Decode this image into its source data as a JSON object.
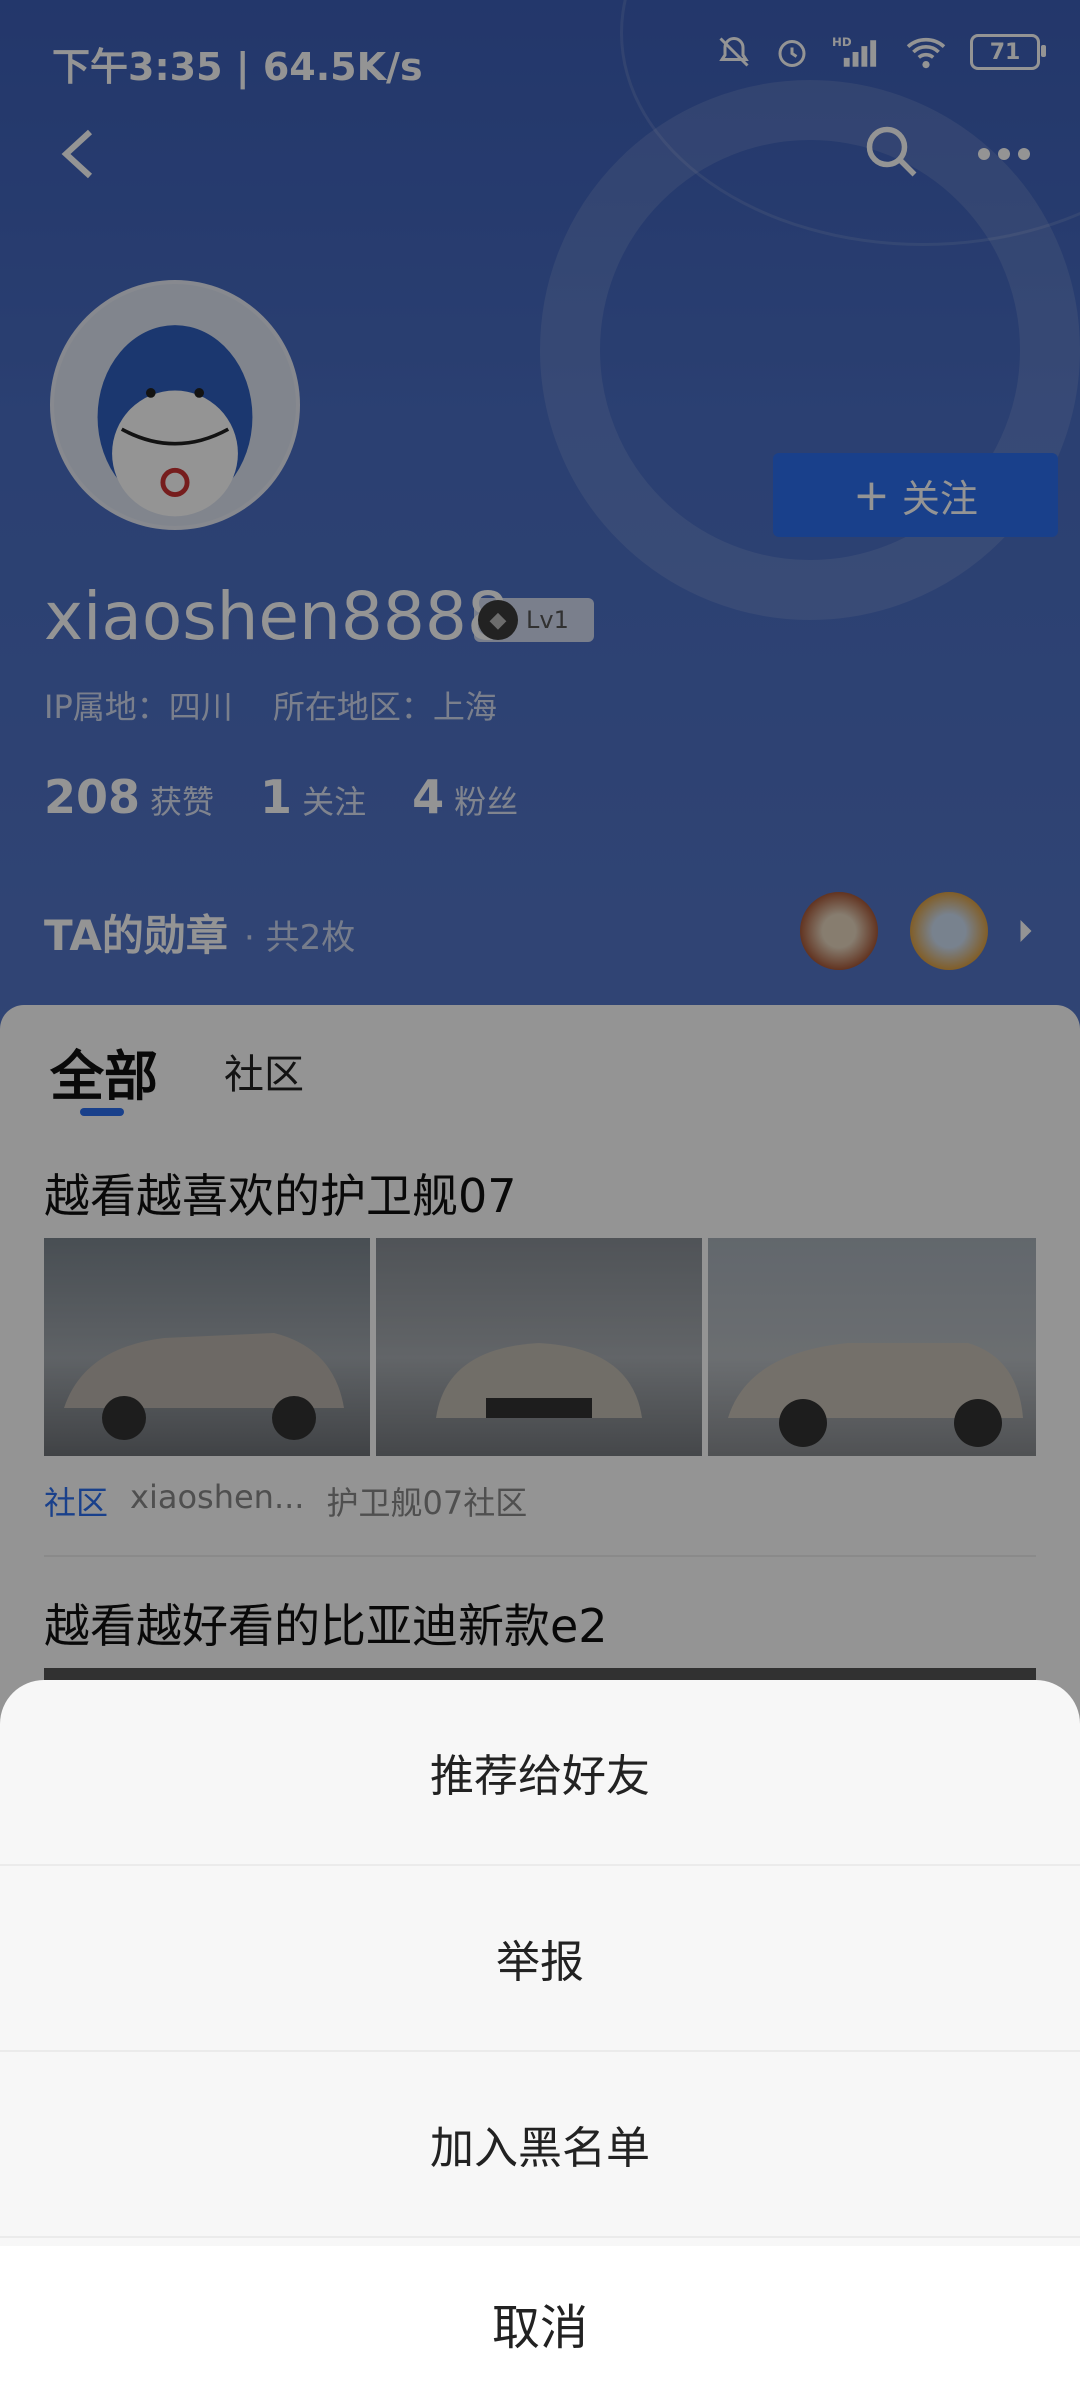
{
  "status_bar": {
    "time_speed": "下午3:35 | 64.5K/s",
    "battery": "71"
  },
  "profile": {
    "username": "xiaoshen8888",
    "level": "Lv1",
    "ip_location": "IP属地：四川",
    "region": "所在地区：上海",
    "follow_label": "关注",
    "stats": [
      {
        "num": "208",
        "label": "获赞"
      },
      {
        "num": "1",
        "label": "关注"
      },
      {
        "num": "4",
        "label": "粉丝"
      }
    ],
    "medal_title": "TA的勋章",
    "medal_count": "· 共2枚"
  },
  "tabs": {
    "all": "全部",
    "community": "社区"
  },
  "posts": [
    {
      "title": "越看越喜欢的护卫舰07",
      "tag": "社区",
      "author": "xiaoshen...",
      "forum": "护卫舰07社区"
    },
    {
      "title": "越看越好看的比亚迪新款e2"
    }
  ],
  "sheet": {
    "items": [
      "推荐给好友",
      "举报",
      "加入黑名单"
    ],
    "cancel": "取消"
  },
  "colors": {
    "header": "#4a6ec4",
    "accent": "#2b6ff0"
  }
}
